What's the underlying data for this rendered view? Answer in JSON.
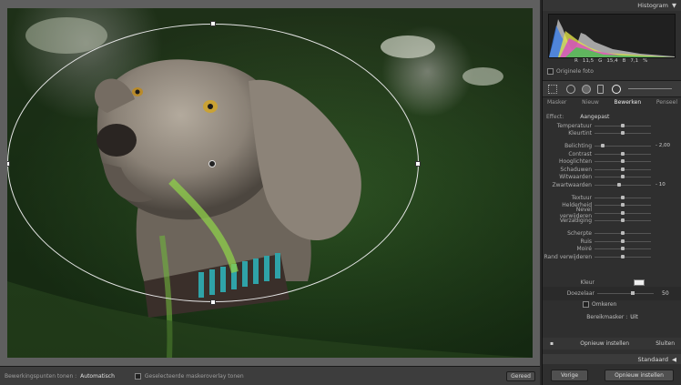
{
  "bottombar": {
    "label": "Bewerkingspunten tonen :",
    "mode": "Automatisch",
    "overlay_label": "Geselecteerde maskeroverlay tonen",
    "done": "Gereed"
  },
  "sidebar": {
    "histogram_title": "Histogram",
    "hist_values": [
      "R",
      "11,5",
      "G",
      "15,4",
      "B",
      "7,1",
      "%"
    ],
    "original_photo": "Originele foto",
    "modes": [
      "Masker",
      "Nieuw",
      "Bewerken",
      "Penseel"
    ],
    "active_mode": "Bewerken",
    "effect_label": "Effect:",
    "effect_value": "Aangepast",
    "sliders1": [
      {
        "name": "Temperatuur",
        "value": "",
        "pos": 0.5
      },
      {
        "name": "Kleurtint",
        "value": "",
        "pos": 0.5
      }
    ],
    "sliders2": [
      {
        "name": "Belichting",
        "value": "- 2,00",
        "pos": 0.12
      },
      {
        "name": "Contrast",
        "value": "",
        "pos": 0.5
      },
      {
        "name": "Hooglichten",
        "value": "",
        "pos": 0.5
      },
      {
        "name": "Schaduwen",
        "value": "",
        "pos": 0.5
      },
      {
        "name": "Witwaarden",
        "value": "",
        "pos": 0.5
      },
      {
        "name": "Zwartwaarden",
        "value": "- 10",
        "pos": 0.43
      }
    ],
    "sliders3": [
      {
        "name": "Textuur",
        "value": "",
        "pos": 0.5
      },
      {
        "name": "Helderheid",
        "value": "",
        "pos": 0.5
      },
      {
        "name": "Nevel verwijderen",
        "value": "",
        "pos": 0.5
      },
      {
        "name": "Verzadiging",
        "value": "",
        "pos": 0.5
      }
    ],
    "sliders4": [
      {
        "name": "Scherpte",
        "value": "",
        "pos": 0.5
      },
      {
        "name": "Ruis",
        "value": "",
        "pos": 0.5
      },
      {
        "name": "Moiré",
        "value": "",
        "pos": 0.5
      },
      {
        "name": "Rand verwijderen",
        "value": "",
        "pos": 0.5
      }
    ],
    "kleur_label": "Kleur",
    "doezelaar_label": "Doezelaar",
    "doezelaar_value": "50",
    "omkeren_label": "Omkeren",
    "bereikmasker_label": "Bereikmasker :",
    "bereikmasker_value": "Uit",
    "opnieuw_instellen": "Opnieuw instellen",
    "sluiten": "Sluiten",
    "standaard": "Standaard",
    "vorige": "Vorige",
    "opnieuw_instellen_btn": "Opnieuw instellen"
  }
}
